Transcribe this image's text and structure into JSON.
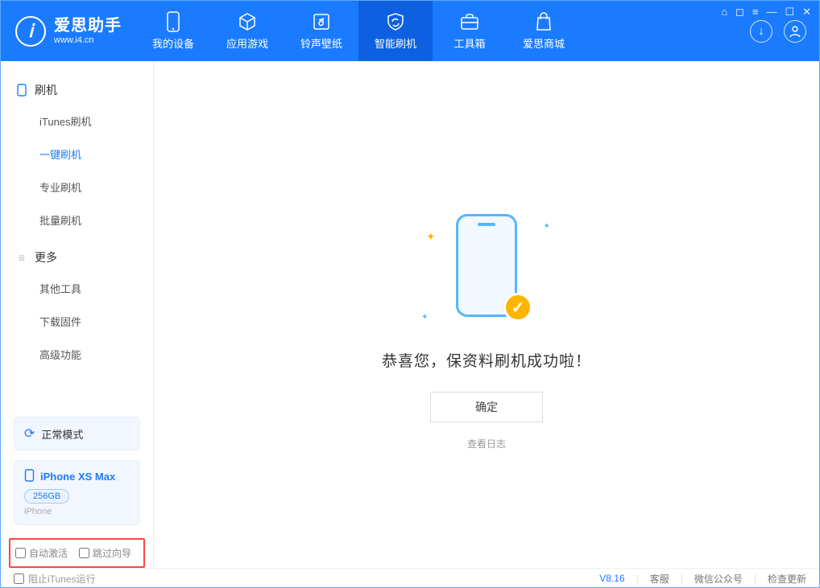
{
  "app": {
    "title": "爱思助手",
    "subtitle": "www.i4.cn"
  },
  "nav": {
    "items": [
      {
        "label": "我的设备"
      },
      {
        "label": "应用游戏"
      },
      {
        "label": "铃声壁纸"
      },
      {
        "label": "智能刷机"
      },
      {
        "label": "工具箱"
      },
      {
        "label": "爱思商城"
      }
    ]
  },
  "sidebar": {
    "group1_title": "刷机",
    "group1_items": [
      {
        "label": "iTunes刷机"
      },
      {
        "label": "一键刷机"
      },
      {
        "label": "专业刷机"
      },
      {
        "label": "批量刷机"
      }
    ],
    "group2_title": "更多",
    "group2_items": [
      {
        "label": "其他工具"
      },
      {
        "label": "下载固件"
      },
      {
        "label": "高级功能"
      }
    ],
    "mode_label": "正常模式",
    "device_name": "iPhone XS Max",
    "device_storage": "256GB",
    "device_type": "iPhone",
    "opt_auto_activate": "自动激活",
    "opt_skip_guide": "跳过向导"
  },
  "main": {
    "message": "恭喜您，保资料刷机成功啦！",
    "ok": "确定",
    "view_log": "查看日志"
  },
  "footer": {
    "block_itunes": "阻止iTunes运行",
    "version": "V8.16",
    "support": "客服",
    "wechat": "微信公众号",
    "update": "检查更新"
  }
}
